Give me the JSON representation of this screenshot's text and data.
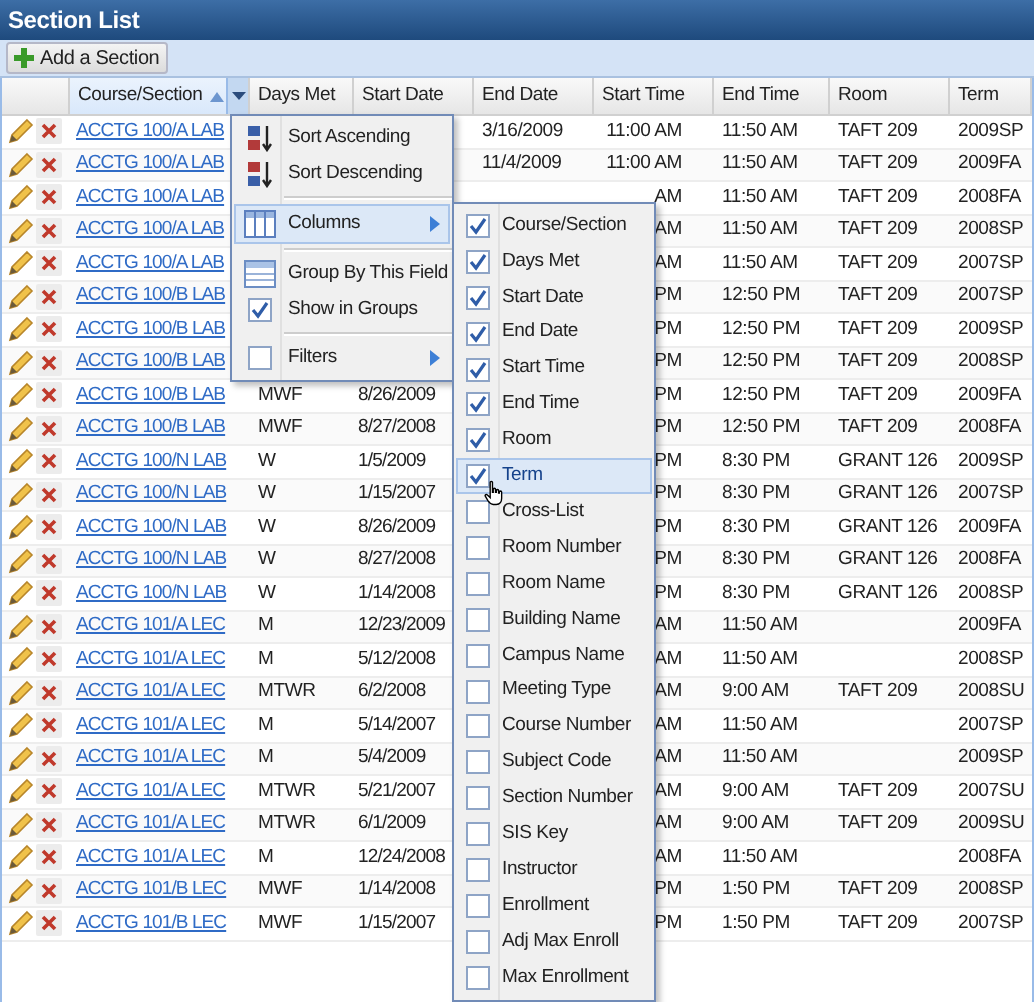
{
  "panel": {
    "title": "Section List"
  },
  "toolbar": {
    "buttons": [
      {
        "label": "Add a Section"
      }
    ]
  },
  "table": {
    "columns": [
      {
        "label": "Course/Section",
        "sorted": true,
        "menu_open": true
      },
      {
        "label": "Days Met",
        "sorted": false,
        "menu_open": false
      },
      {
        "label": "Start Date",
        "sorted": false,
        "menu_open": false
      },
      {
        "label": "End Date",
        "sorted": false,
        "menu_open": false
      },
      {
        "label": "Start Time",
        "sorted": false,
        "menu_open": false
      },
      {
        "label": "End Time",
        "sorted": false,
        "menu_open": false
      },
      {
        "label": "Room",
        "sorted": false,
        "menu_open": false
      },
      {
        "label": "Term",
        "sorted": false,
        "menu_open": false
      }
    ],
    "rows": [
      {
        "course": "ACCTG 100/A LAB",
        "end_date": "3/16/2009",
        "start_time": "11:00 AM",
        "end_time": "11:50 AM",
        "room": "TAFT 209",
        "term": "2009SP"
      },
      {
        "course": "ACCTG 100/A LAB",
        "end_date": "11/4/2009",
        "start_time": "11:00 AM",
        "end_time": "11:50 AM",
        "room": "TAFT 209",
        "term": "2009FA"
      },
      {
        "course": "ACCTG 100/A LAB",
        "start_time": "AM",
        "end_time": "11:50 AM",
        "room": "TAFT 209",
        "term": "2008FA"
      },
      {
        "course": "ACCTG 100/A LAB",
        "start_time": "AM",
        "end_time": "11:50 AM",
        "room": "TAFT 209",
        "term": "2008SP"
      },
      {
        "course": "ACCTG 100/A LAB",
        "start_time": "AM",
        "end_time": "11:50 AM",
        "room": "TAFT 209",
        "term": "2007SP"
      },
      {
        "course": "ACCTG 100/B LAB",
        "start_time": "PM",
        "end_time": "12:50 PM",
        "room": "TAFT 209",
        "term": "2007SP"
      },
      {
        "course": "ACCTG 100/B LAB",
        "start_time": "PM",
        "end_time": "12:50 PM",
        "room": "TAFT 209",
        "term": "2009SP"
      },
      {
        "course": "ACCTG 100/B LAB",
        "start_time": "PM",
        "end_time": "12:50 PM",
        "room": "TAFT 209",
        "term": "2008SP"
      },
      {
        "course": "ACCTG 100/B LAB",
        "days_met": "MWF",
        "start_date": "8/26/2009",
        "start_time": "PM",
        "end_time": "12:50 PM",
        "room": "TAFT 209",
        "term": "2009FA"
      },
      {
        "course": "ACCTG 100/B LAB",
        "days_met": "MWF",
        "start_date": "8/27/2008",
        "start_time": "PM",
        "end_time": "12:50 PM",
        "room": "TAFT 209",
        "term": "2008FA"
      },
      {
        "course": "ACCTG 100/N LAB",
        "days_met": "W",
        "start_date": "1/5/2009",
        "start_time": "PM",
        "end_time": "8:30 PM",
        "room": "GRANT 126",
        "term": "2009SP"
      },
      {
        "course": "ACCTG 100/N LAB",
        "days_met": "W",
        "start_date": "1/15/2007",
        "start_time": "PM",
        "end_time": "8:30 PM",
        "room": "GRANT 126",
        "term": "2007SP"
      },
      {
        "course": "ACCTG 100/N LAB",
        "days_met": "W",
        "start_date": "8/26/2009",
        "start_time": "PM",
        "end_time": "8:30 PM",
        "room": "GRANT 126",
        "term": "2009FA"
      },
      {
        "course": "ACCTG 100/N LAB",
        "days_met": "W",
        "start_date": "8/27/2008",
        "start_time": "PM",
        "end_time": "8:30 PM",
        "room": "GRANT 126",
        "term": "2008FA"
      },
      {
        "course": "ACCTG 100/N LAB",
        "days_met": "W",
        "start_date": "1/14/2008",
        "start_time": "PM",
        "end_time": "8:30 PM",
        "room": "GRANT 126",
        "term": "2008SP"
      },
      {
        "course": "ACCTG 101/A LEC",
        "days_met": "M",
        "start_date": "12/23/2009",
        "start_time": "AM",
        "end_time": "11:50 AM",
        "term": "2009FA"
      },
      {
        "course": "ACCTG 101/A LEC",
        "days_met": "M",
        "start_date": "5/12/2008",
        "start_time": "AM",
        "end_time": "11:50 AM",
        "term": "2008SP"
      },
      {
        "course": "ACCTG 101/A LEC",
        "days_met": "MTWR",
        "start_date": "6/2/2008",
        "start_time": "AM",
        "end_time": "9:00 AM",
        "room": "TAFT 209",
        "term": "2008SU"
      },
      {
        "course": "ACCTG 101/A LEC",
        "days_met": "M",
        "start_date": "5/14/2007",
        "start_time": "AM",
        "end_time": "11:50 AM",
        "term": "2007SP"
      },
      {
        "course": "ACCTG 101/A LEC",
        "days_met": "M",
        "start_date": "5/4/2009",
        "start_time": "AM",
        "end_time": "11:50 AM",
        "term": "2009SP"
      },
      {
        "course": "ACCTG 101/A LEC",
        "days_met": "MTWR",
        "start_date": "5/21/2007",
        "start_time": "AM",
        "end_time": "9:00 AM",
        "room": "TAFT 209",
        "term": "2007SU"
      },
      {
        "course": "ACCTG 101/A LEC",
        "days_met": "MTWR",
        "start_date": "6/1/2009",
        "start_time": "AM",
        "end_time": "9:00 AM",
        "room": "TAFT 209",
        "term": "2009SU"
      },
      {
        "course": "ACCTG 101/A LEC",
        "days_met": "M",
        "start_date": "12/24/2008",
        "start_time": "AM",
        "end_time": "11:50 AM",
        "term": "2008FA"
      },
      {
        "course": "ACCTG 101/B LEC",
        "days_met": "MWF",
        "start_date": "1/14/2008",
        "start_time": "PM",
        "end_time": "1:50 PM",
        "room": "TAFT 209",
        "term": "2008SP"
      },
      {
        "course": "ACCTG 101/B LEC",
        "days_met": "MWF",
        "start_date": "1/15/2007",
        "start_time": "PM",
        "end_time": "1:50 PM",
        "room": "TAFT 209",
        "term": "2007SP"
      }
    ]
  },
  "column_menu": {
    "items": [
      {
        "kind": "sort_asc",
        "label": "Sort Ascending",
        "selected": false
      },
      {
        "kind": "sort_desc",
        "label": "Sort Descending",
        "selected": false
      },
      {
        "kind": "columns",
        "label": "Columns",
        "selected": true,
        "separator_before": true,
        "submenu": true
      },
      {
        "kind": "group",
        "label": "Group By This Field",
        "selected": false,
        "separator_before": true
      },
      {
        "kind": "check",
        "label": "Show in Groups",
        "checked": true,
        "selected": false
      },
      {
        "kind": "check",
        "label": "Filters",
        "checked": false,
        "selected": false,
        "separator_before": true,
        "submenu": true
      }
    ]
  },
  "columns_submenu": {
    "items": [
      {
        "label": "Course/Section",
        "checked": true,
        "selected": false
      },
      {
        "label": "Days Met",
        "checked": true,
        "selected": false
      },
      {
        "label": "Start Date",
        "checked": true,
        "selected": false
      },
      {
        "label": "End Date",
        "checked": true,
        "selected": false
      },
      {
        "label": "Start Time",
        "checked": true,
        "selected": false
      },
      {
        "label": "End Time",
        "checked": true,
        "selected": false
      },
      {
        "label": "Room",
        "checked": true,
        "selected": false
      },
      {
        "label": "Term",
        "checked": true,
        "selected": true
      },
      {
        "label": "Cross-List",
        "checked": false,
        "selected": false
      },
      {
        "label": "Room Number",
        "checked": false,
        "selected": false
      },
      {
        "label": "Room Name",
        "checked": false,
        "selected": false
      },
      {
        "label": "Building Name",
        "checked": false,
        "selected": false
      },
      {
        "label": "Campus Name",
        "checked": false,
        "selected": false
      },
      {
        "label": "Meeting Type",
        "checked": false,
        "selected": false
      },
      {
        "label": "Course Number",
        "checked": false,
        "selected": false
      },
      {
        "label": "Subject Code",
        "checked": false,
        "selected": false
      },
      {
        "label": "Section Number",
        "checked": false,
        "selected": false
      },
      {
        "label": "SIS Key",
        "checked": false,
        "selected": false
      },
      {
        "label": "Instructor",
        "checked": false,
        "selected": false
      },
      {
        "label": "Enrollment",
        "checked": false,
        "selected": false
      },
      {
        "label": "Adj Max Enroll",
        "checked": false,
        "selected": false
      },
      {
        "label": "Max Enrollment",
        "checked": false,
        "selected": false
      }
    ]
  }
}
